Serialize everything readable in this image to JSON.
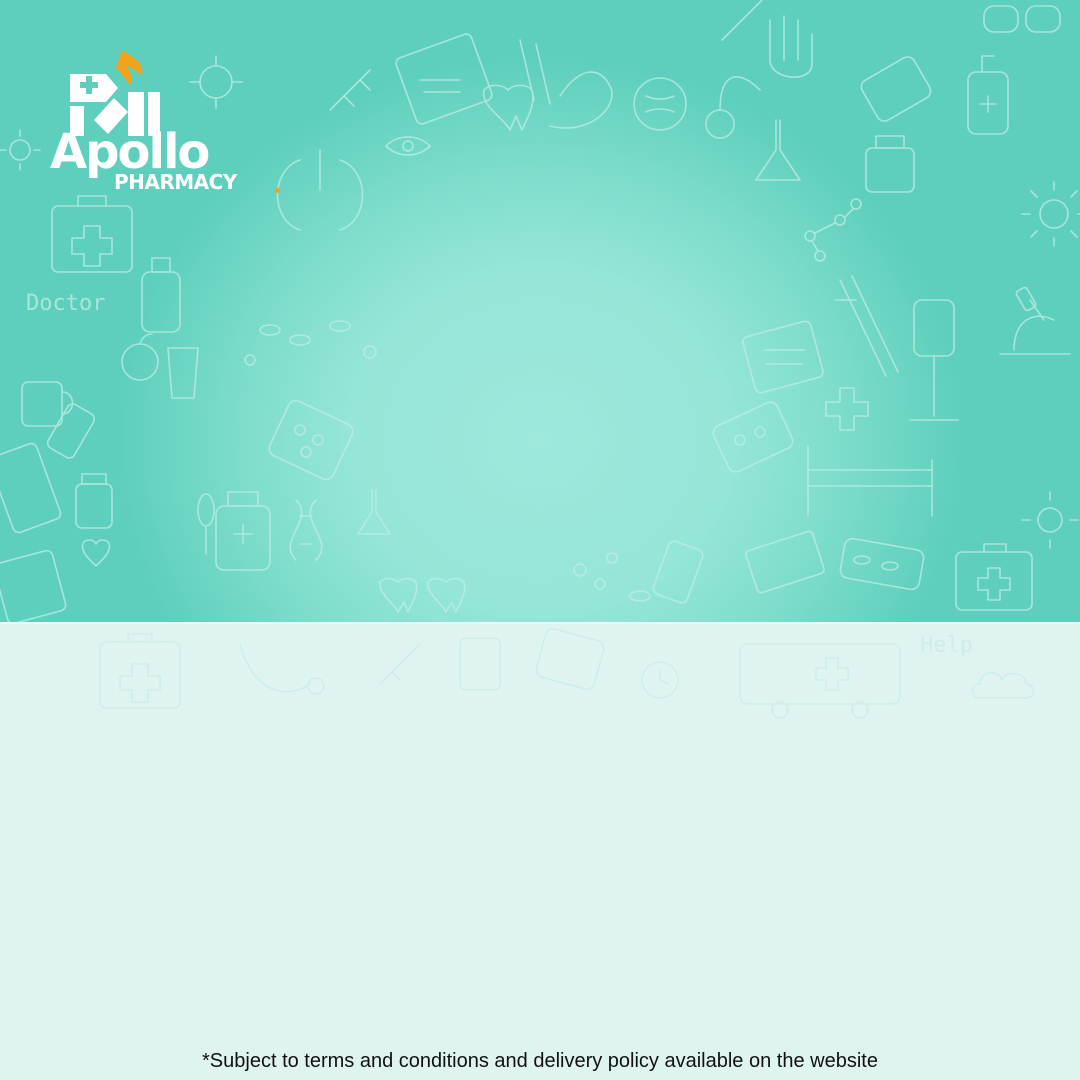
{
  "brand": {
    "name": "Apollo",
    "tagline": "PHARMACY",
    "logo_icon": "apollo-pharmacy-logo-icon",
    "colors": {
      "flame": "#f2a31b",
      "logo_text": "#ffffff"
    }
  },
  "background": {
    "theme_color": "#5fcfbd",
    "glow_color": "#9ee8dc",
    "floor_color": "#dff4f1",
    "doodle_word_doctor": "Doctor",
    "doodle_word_help": "Help"
  },
  "footer": {
    "disclaimer": "*Subject to terms and conditions and delivery policy available on the website"
  }
}
